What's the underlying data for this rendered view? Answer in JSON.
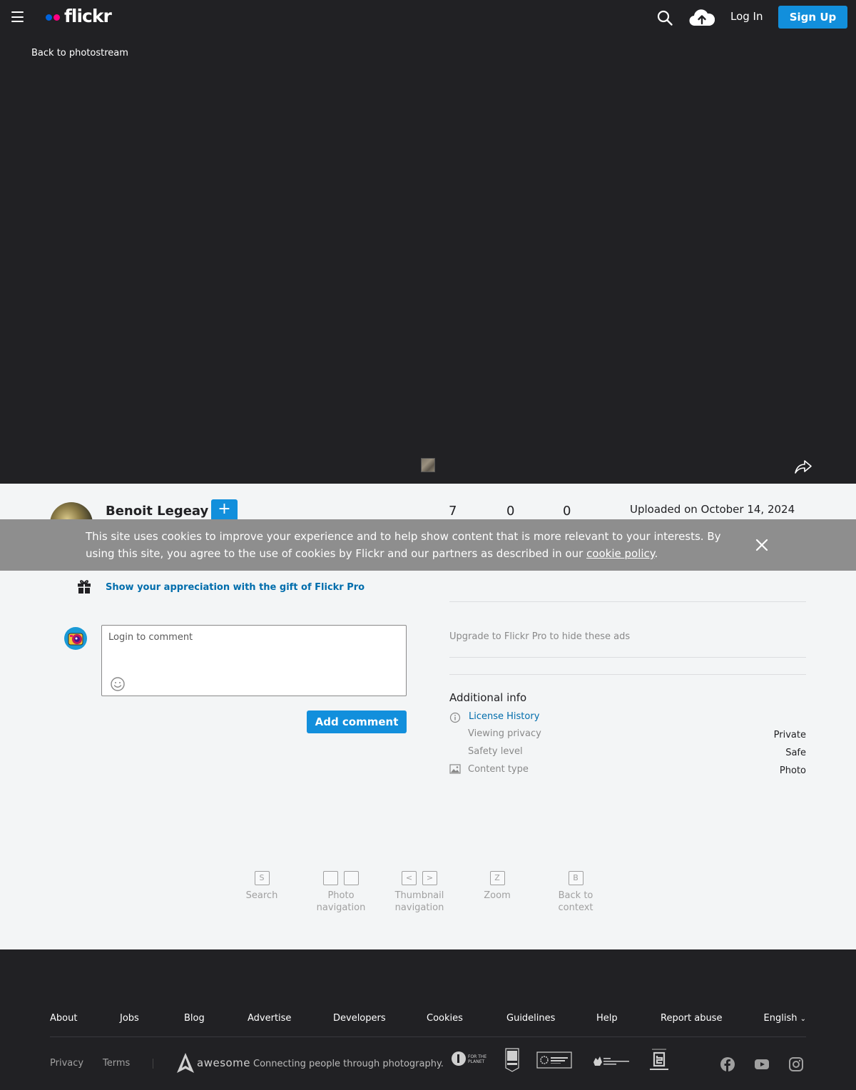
{
  "topnav": {
    "logo_text": "flickr",
    "login_label": "Log In",
    "signup_label": "Sign Up"
  },
  "viewer": {
    "back_label": "Back to photostream"
  },
  "photo": {
    "owner_name": "Benoit Legeay",
    "follow_label": "+",
    "stats": [
      "7",
      "0",
      "0"
    ],
    "uploaded": "Uploaded on October 14, 2024"
  },
  "cookie_banner": {
    "text": "This site uses cookies to improve your experience and to help show content that is more relevant to your interests. By using this site, you agree to the use of cookies by Flickr and our partners as described in our ",
    "link_label": "cookie policy",
    "end": "."
  },
  "gift": {
    "label": "Show your appreciation with the gift of Flickr Pro"
  },
  "comment": {
    "placeholder": "Login to comment",
    "add_label": "Add comment"
  },
  "sidebar": {
    "upgrade_ads": "Upgrade to Flickr Pro to hide these ads",
    "additional_info_title": "Additional info",
    "license_history": "License History",
    "rows": [
      {
        "label": "Viewing privacy",
        "value": "Private"
      },
      {
        "label": "Safety level",
        "value": "Safe"
      },
      {
        "label": "Content type",
        "value": "Photo"
      }
    ]
  },
  "shortcuts": [
    {
      "keys": [
        "S"
      ],
      "label": "Search"
    },
    {
      "keys": [
        "",
        ""
      ],
      "label": "Photo navigation"
    },
    {
      "keys": [
        "<",
        ">"
      ],
      "label": "Thumbnail navigation"
    },
    {
      "keys": [
        "Z"
      ],
      "label": "Zoom"
    },
    {
      "keys": [
        "B"
      ],
      "label": "Back to context"
    }
  ],
  "footer": {
    "links": [
      "About",
      "Jobs",
      "Blog",
      "Advertise",
      "Developers",
      "Cookies",
      "Guidelines",
      "Help",
      "Report abuse"
    ],
    "language": "English",
    "privacy": "Privacy",
    "terms": "Terms",
    "awesome": "awesome",
    "tagline": "Connecting people through photography."
  },
  "colors": {
    "accent": "#128fdc",
    "link": "#006dac",
    "dark": "#212124",
    "flickr_blue": "#0063dc",
    "flickr_pink": "#ff0084"
  }
}
